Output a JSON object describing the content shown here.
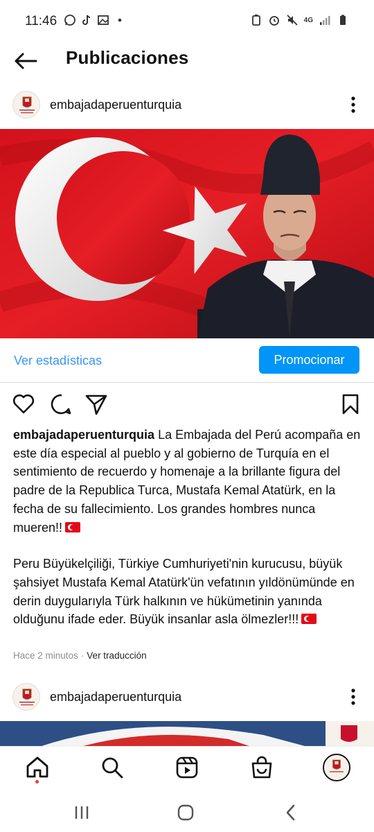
{
  "status_bar": {
    "time": "11:46",
    "network": "4G"
  },
  "header": {
    "title": "Publicaciones"
  },
  "post": {
    "username": "embajadaperuenturquia",
    "insights_label": "Ver estadísticas",
    "promote_label": "Promocionar",
    "caption_user": "embajadaperuenturquia",
    "caption_text_1": "La Embajada del Perú acompaña en este día especial al pueblo y al gobierno de Turquía en el sentimiento de recuerdo y homenaje a la brillante figura del padre de la Republica Turca, Mustafa Kemal Atatürk, en la fecha de su fallecimiento. Los grandes hombres nunca mueren!!",
    "caption_text_2": "Peru Büyükelçiliği, Türkiye Cumhuriyeti'nin kurucusu, büyük şahsiyet Mustafa Kemal Atatürk'ün vefatının yıldönümünde en derin duygularıyla Türk halkının ve hükümetinin yanında olduğunu ifade eder. Büyük insanlar asla ölmezler!!!",
    "time_ago": "Hace 2 minutos",
    "separator": "·",
    "translate_label": "Ver traducción"
  },
  "post2": {
    "username": "embajadaperuenturquia"
  },
  "colors": {
    "accent_blue": "#0095f6",
    "link_blue": "#3897f0",
    "flag_red": "#e30a17"
  },
  "icons": {
    "back": "arrow-left-icon",
    "more": "more-vertical-icon",
    "like": "heart-icon",
    "comment": "comment-icon",
    "share": "send-icon",
    "save": "bookmark-icon",
    "home": "home-icon",
    "search": "search-icon",
    "reels": "reels-icon",
    "shop": "shop-icon"
  }
}
